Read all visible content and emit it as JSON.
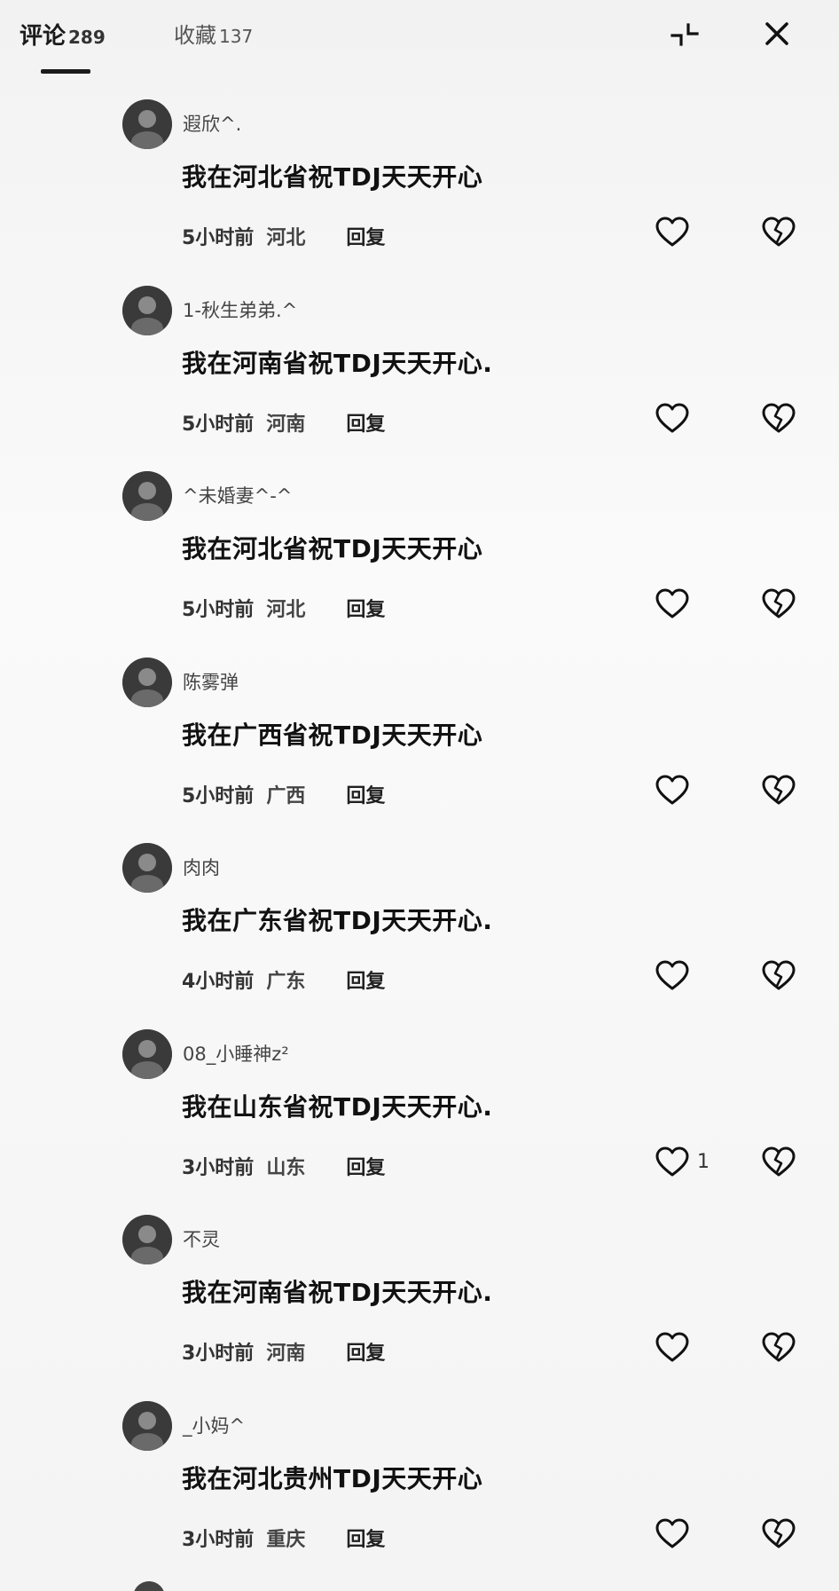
{
  "header": {
    "tabs": [
      {
        "label": "评论",
        "count": "289"
      },
      {
        "label": "收藏",
        "count": "137"
      }
    ],
    "collapse_icon": "collapse-icon",
    "close_icon": "close-icon"
  },
  "comments": [
    {
      "username": "遐欣^.",
      "text": "我在河北省祝TDJ天天开心",
      "time": "5小时前",
      "region": "河北",
      "reply": "回复",
      "likes": ""
    },
    {
      "username": "1-秋生弟弟.^",
      "text": "我在河南省祝TDJ天天开心.",
      "time": "5小时前",
      "region": "河南",
      "reply": "回复",
      "likes": ""
    },
    {
      "username": "^未婚妻^-^",
      "text": "我在河北省祝TDJ天天开心",
      "time": "5小时前",
      "region": "河北",
      "reply": "回复",
      "likes": ""
    },
    {
      "username": "陈雾弹",
      "text": "我在广西省祝TDJ天天开心",
      "time": "5小时前",
      "region": "广西",
      "reply": "回复",
      "likes": ""
    },
    {
      "username": "肉肉",
      "text": "我在广东省祝TDJ天天开心.",
      "time": "4小时前",
      "region": "广东",
      "reply": "回复",
      "likes": ""
    },
    {
      "username": "08_小睡神z²",
      "text": "我在山东省祝TDJ天天开心.",
      "time": "3小时前",
      "region": "山东",
      "reply": "回复",
      "likes": "1"
    },
    {
      "username": "不灵",
      "text": "我在河南省祝TDJ天天开心.",
      "time": "3小时前",
      "region": "河南",
      "reply": "回复",
      "likes": ""
    },
    {
      "username": "_小妈^",
      "text": "我在河北贵州TDJ天天开心",
      "time": "3小时前",
      "region": "重庆",
      "reply": "回复",
      "likes": ""
    }
  ],
  "icons": {
    "like": "heart-outline-icon",
    "dislike": "broken-heart-icon"
  }
}
